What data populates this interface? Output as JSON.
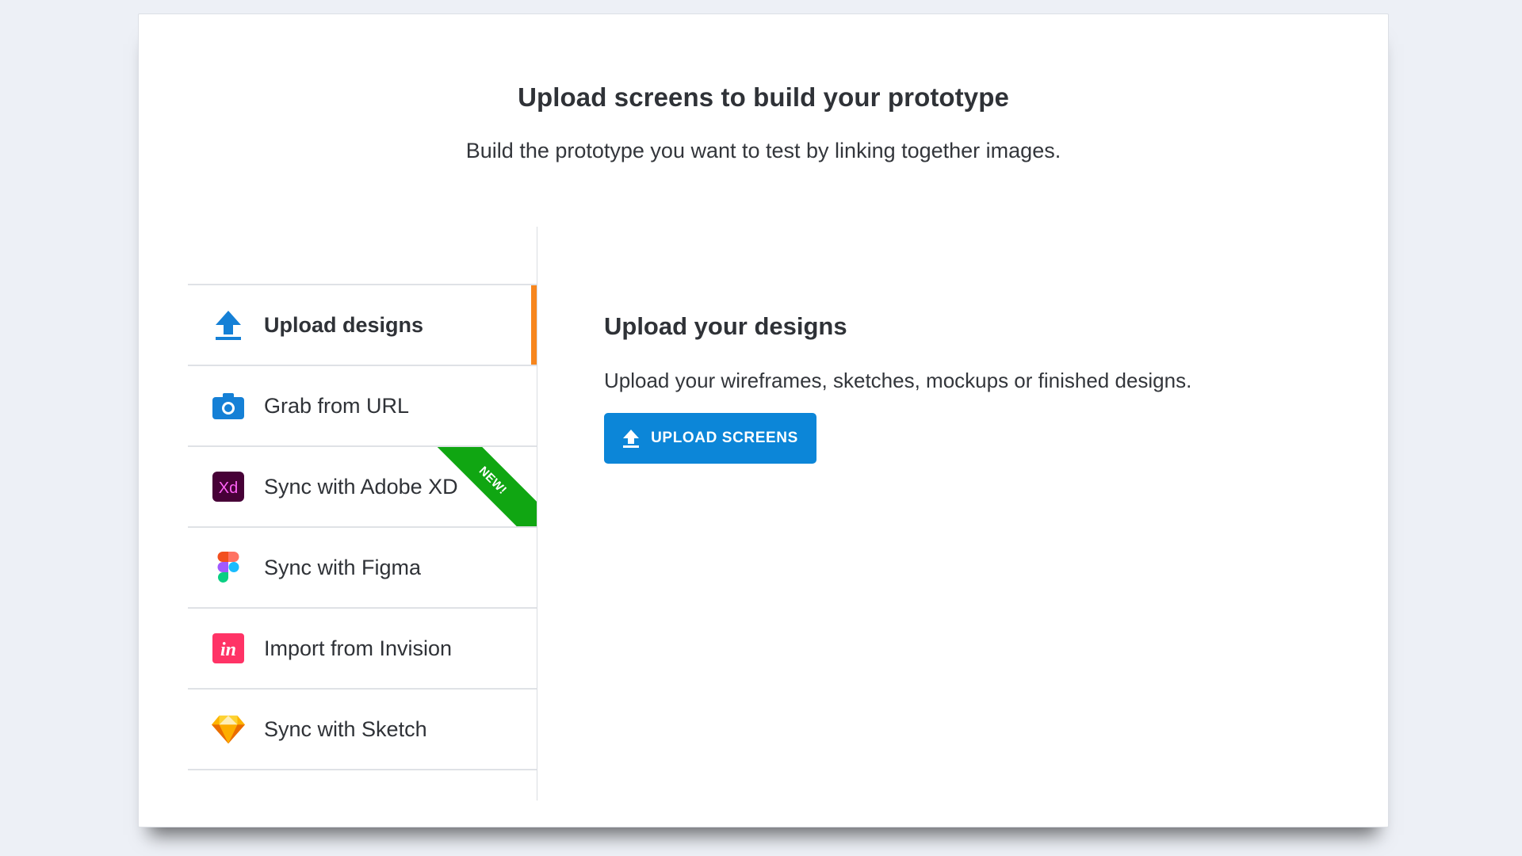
{
  "header": {
    "title": "Upload screens to build your prototype",
    "subtitle": "Build the prototype you want to test by linking together images."
  },
  "menu": {
    "active_index": 0,
    "accent_color": "#f7861d",
    "items": [
      {
        "label": "Upload designs",
        "icon": "upload-arrow-icon"
      },
      {
        "label": "Grab from URL",
        "icon": "camera-icon"
      },
      {
        "label": "Sync with Adobe XD",
        "icon": "adobe-xd-icon",
        "badge": "NEW!"
      },
      {
        "label": "Sync with Figma",
        "icon": "figma-icon"
      },
      {
        "label": "Import from Invision",
        "icon": "invision-icon"
      },
      {
        "label": "Sync with Sketch",
        "icon": "sketch-icon"
      }
    ]
  },
  "panel": {
    "title": "Upload your designs",
    "description": "Upload your wireframes, sketches, mockups or finished designs.",
    "button_label": "UPLOAD SCREENS",
    "button_color": "#0c86d8"
  },
  "icons": {
    "xd_text": "Xd",
    "invision_text": "in"
  }
}
